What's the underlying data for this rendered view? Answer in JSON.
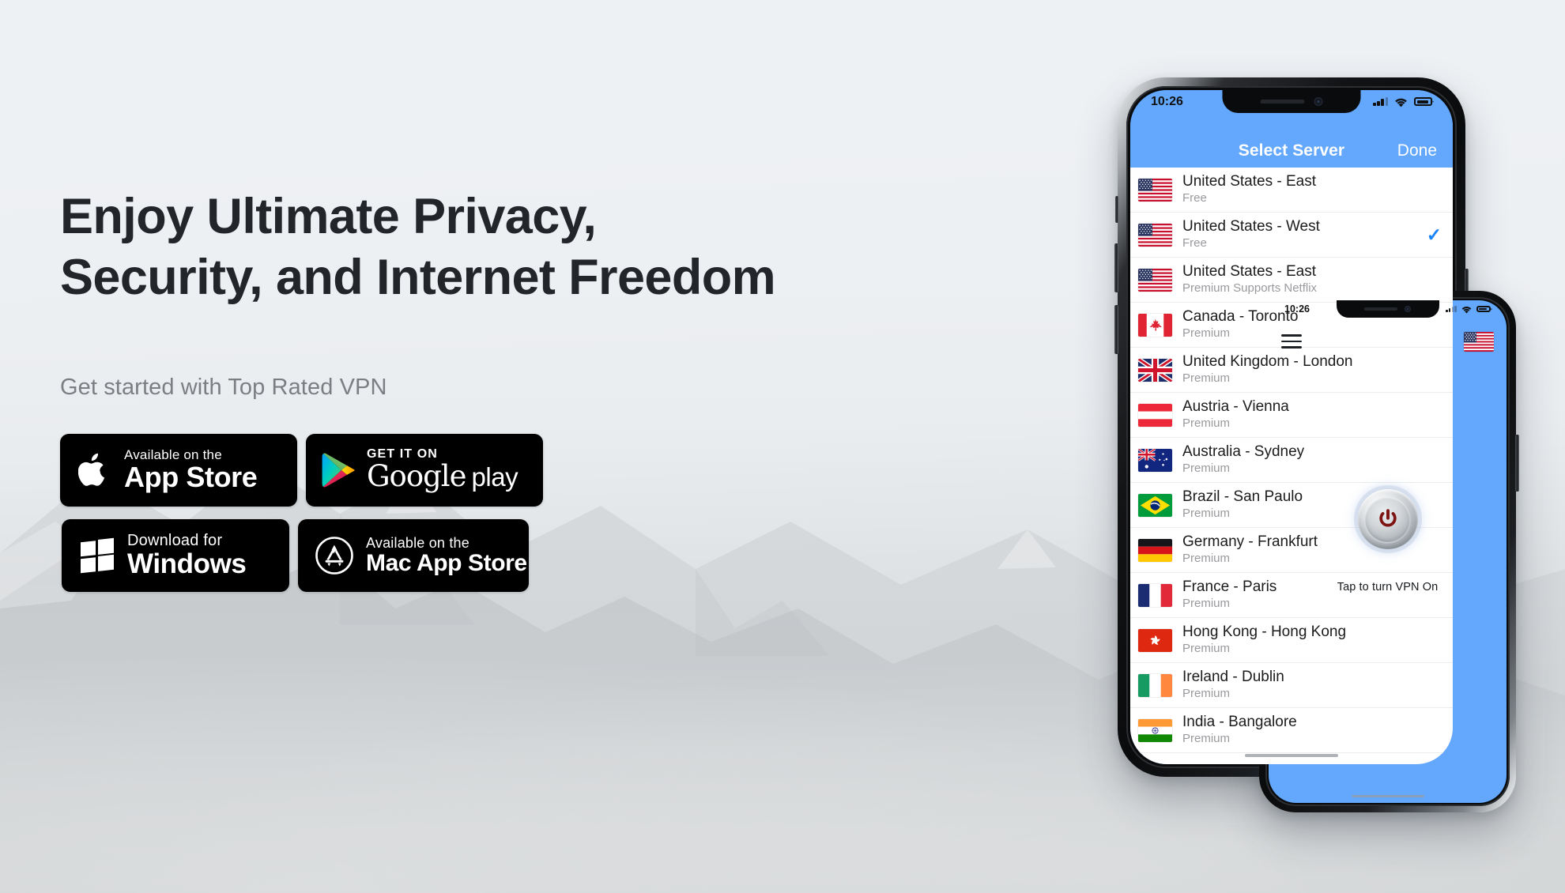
{
  "hero": {
    "headline": "Enjoy Ultimate Privacy,\nSecurity, and Internet Freedom",
    "subhead": "Get started with Top Rated VPN",
    "headline_color": "#22262a",
    "subhead_color": "#7b7f83",
    "background_color": "#eef1f3"
  },
  "badges": {
    "app_store": {
      "icon": "apple-logo-icon",
      "top_line": "Available on the",
      "main_line": "App Store"
    },
    "google_play": {
      "icon": "google-play-triangle-icon",
      "top_line": "GET IT ON",
      "main_line": "Google",
      "secondary_line": "play"
    },
    "windows": {
      "icon": "windows-logo-icon",
      "top_line": "Download for",
      "main_line": "Windows"
    },
    "mac_app_store": {
      "icon": "mac-app-store-icon",
      "top_line": "Available on the",
      "main_line": "Mac App Store"
    }
  },
  "phone_back": {
    "status_bar": {
      "time": "10:26",
      "signal": "cellular-bars-icon",
      "wifi": "wifi-icon",
      "battery": "battery-icon"
    },
    "navbar": {
      "title": "Select Server",
      "done_label": "Done"
    },
    "accent_color": "#63a8fd",
    "check_color": "#1a84ff",
    "servers": [
      {
        "flag": "us",
        "name": "United States - East",
        "tier": "Free",
        "selected": false
      },
      {
        "flag": "us",
        "name": "United States - West",
        "tier": "Free",
        "selected": true
      },
      {
        "flag": "us",
        "name": "United States - East",
        "tier": "Premium Supports Netflix",
        "selected": false
      },
      {
        "flag": "ca",
        "name": "Canada - Toronto",
        "tier": "Premium",
        "selected": false
      },
      {
        "flag": "gb",
        "name": "United Kingdom - London",
        "tier": "Premium",
        "selected": false
      },
      {
        "flag": "at",
        "name": "Austria - Vienna",
        "tier": "Premium",
        "selected": false
      },
      {
        "flag": "au",
        "name": "Australia - Sydney",
        "tier": "Premium",
        "selected": false
      },
      {
        "flag": "br",
        "name": "Brazil - San Paulo",
        "tier": "Premium",
        "selected": false
      },
      {
        "flag": "de",
        "name": "Germany - Frankfurt",
        "tier": "Premium",
        "selected": false
      },
      {
        "flag": "fr",
        "name": "France - Paris",
        "tier": "Premium",
        "selected": false
      },
      {
        "flag": "hk",
        "name": "Hong Kong - Hong Kong",
        "tier": "Premium",
        "selected": false
      },
      {
        "flag": "ie",
        "name": "Ireland - Dublin",
        "tier": "Premium",
        "selected": false
      },
      {
        "flag": "in",
        "name": "India - Bangalore",
        "tier": "Premium",
        "selected": false
      }
    ]
  },
  "phone_front": {
    "status_bar": {
      "time": "10:26",
      "signal": "cellular-bars-icon",
      "wifi": "wifi-icon",
      "battery": "battery-icon"
    },
    "topbar": {
      "menu_icon": "hamburger-menu-icon",
      "flag": "us"
    },
    "power_button": {
      "icon": "power-icon",
      "glyph_color": "#7d1411"
    },
    "status_label": "Tap to turn VPN On",
    "screen_color": "#63a8fd"
  }
}
